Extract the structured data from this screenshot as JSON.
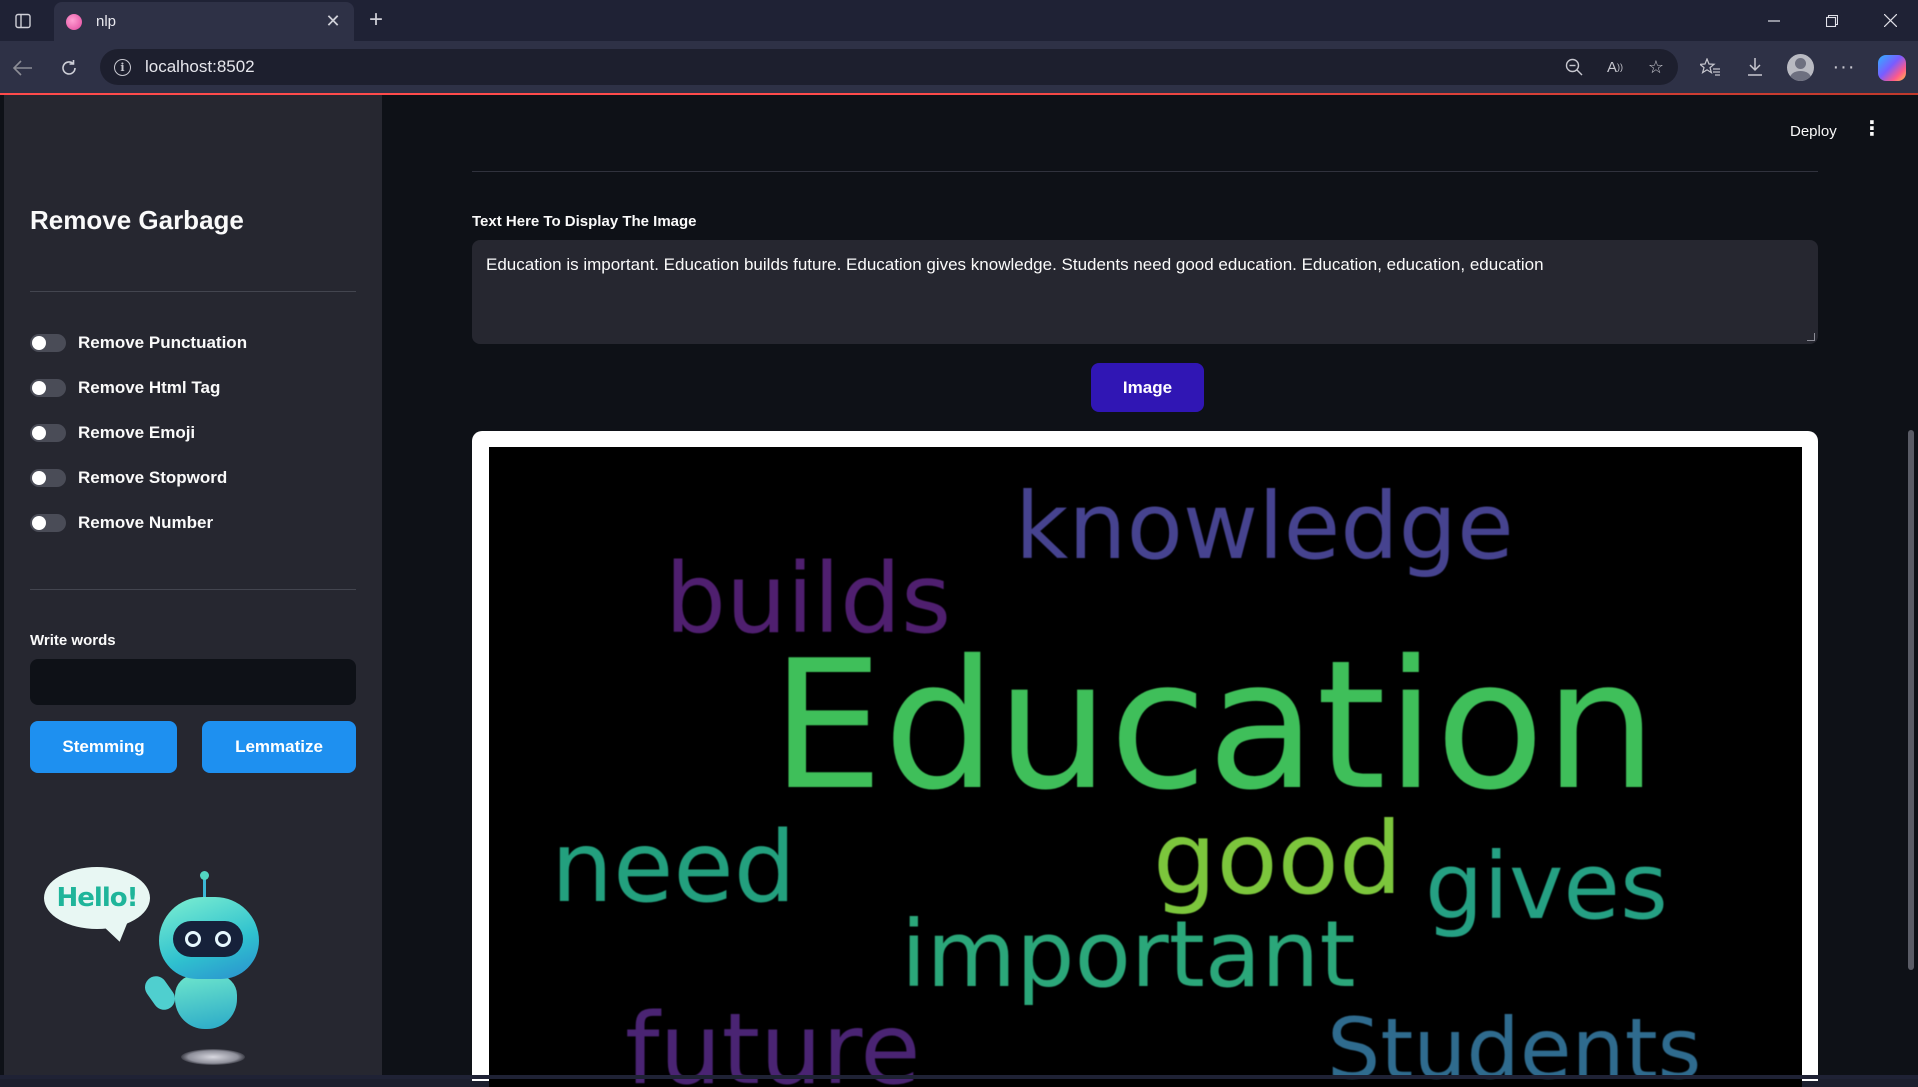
{
  "browser": {
    "tab_title": "nlp",
    "url": "localhost:8502",
    "icons": {
      "sidebar_toggle": "sidebar-toggle-icon",
      "close_tab": "close-icon",
      "new_tab": "plus-icon",
      "back": "back-arrow-icon",
      "reload": "reload-icon",
      "site_info": "info-icon",
      "zoom": "zoom-out-icon",
      "read_aloud": "read-aloud-icon",
      "favorite": "star-icon",
      "favorites": "favorites-icon",
      "downloads": "download-icon",
      "profile": "profile-icon",
      "more": "more-icon",
      "copilot": "copilot-icon"
    },
    "accent_color": "#ff4b4b"
  },
  "sidebar": {
    "title": "Remove Garbage",
    "toggles": [
      {
        "label": "Remove Punctuation",
        "on": false
      },
      {
        "label": "Remove Html Tag",
        "on": false
      },
      {
        "label": "Remove Emoji",
        "on": false
      },
      {
        "label": "Remove Stopword",
        "on": false
      },
      {
        "label": "Remove Number",
        "on": false
      }
    ],
    "write_words_label": "Write words",
    "write_words_value": "",
    "stemming_label": "Stemming",
    "lemmatize_label": "Lemmatize",
    "button_color": "#1e90f0",
    "robot_greeting": "Hello!"
  },
  "header": {
    "deploy_label": "Deploy",
    "menu_icon": "vertical-dots-icon"
  },
  "main": {
    "text_label": "Text Here To Display The Image",
    "text_value": "Education is important. Education builds future. Education gives knowledge. Students need good education. Education, education, education",
    "image_button_label": "Image",
    "image_button_color": "#3016b4"
  },
  "wordcloud": {
    "words": [
      {
        "text": "Education",
        "color": "#3fbf5a"
      },
      {
        "text": "knowledge",
        "color": "#46438f"
      },
      {
        "text": "builds",
        "color": "#4f1f6f"
      },
      {
        "text": "need",
        "color": "#23a07e"
      },
      {
        "text": "good",
        "color": "#7cc63c"
      },
      {
        "text": "gives",
        "color": "#25a083"
      },
      {
        "text": "important",
        "color": "#2ba77a"
      },
      {
        "text": "future",
        "color": "#4a2473"
      },
      {
        "text": "Students",
        "color": "#2f6b8e"
      }
    ]
  }
}
